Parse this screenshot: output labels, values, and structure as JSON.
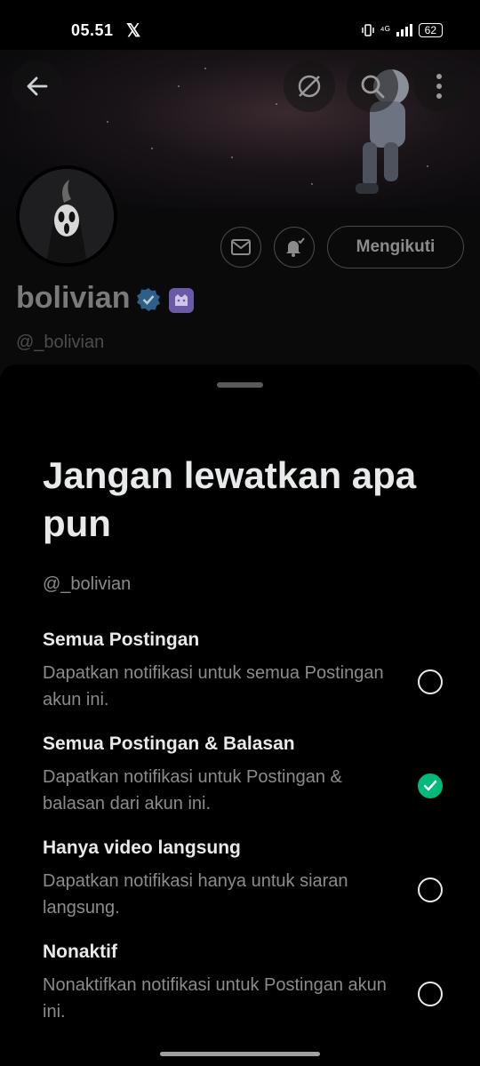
{
  "status_bar": {
    "time": "05.51",
    "x_logo": "𝕏",
    "network": "⁴ᴳ",
    "battery": "62"
  },
  "profile": {
    "name": "bolivian",
    "handle": "@_bolivian",
    "follow_label": "Mengikuti"
  },
  "sheet": {
    "title": "Jangan lewatkan apa pun",
    "handle": "@_bolivian",
    "options": [
      {
        "title": "Semua Postingan",
        "description": "Dapatkan notifikasi untuk semua Postingan akun ini.",
        "selected": false
      },
      {
        "title": "Semua Postingan & Balasan",
        "description": "Dapatkan notifikasi untuk Postingan & balasan dari akun ini.",
        "selected": true
      },
      {
        "title": "Hanya video langsung",
        "description": "Dapatkan notifikasi hanya untuk siaran langsung.",
        "selected": false
      },
      {
        "title": "Nonaktif",
        "description": "Nonaktifkan notifikasi untuk Postingan akun ini.",
        "selected": false
      }
    ]
  },
  "colors": {
    "accent_green": "#00ba7c",
    "verified_blue": "#1d9bf0"
  },
  "icons": [
    "back-arrow-icon",
    "grok-icon",
    "search-icon",
    "more-vertical-icon",
    "mail-icon",
    "bell-check-icon",
    "verified-icon",
    "badge-icon",
    "check-icon"
  ]
}
